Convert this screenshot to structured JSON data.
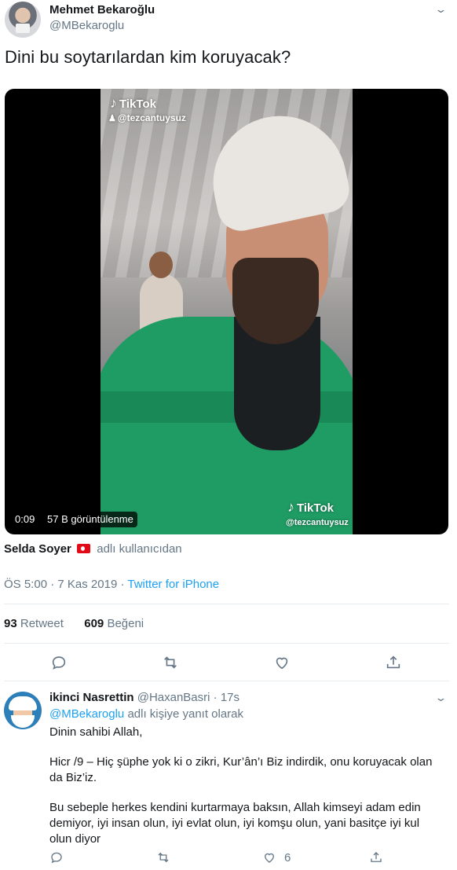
{
  "tweet": {
    "author": {
      "name": "Mehmet Bekaroğlu",
      "handle": "@MBekaroglu",
      "avatar_icon": "profile-photo"
    },
    "text": "Dini bu soytarılardan kim koruyacak?",
    "video": {
      "watermark_brand": "TikTok",
      "watermark_handle": "@tezcantuysuz",
      "duration": "0:09",
      "views": "57 B görüntülenme"
    },
    "source": {
      "user": "Selda Soyer",
      "flag_icon": "turkey-flag-icon",
      "suffix": "adlı kullanıcıdan"
    },
    "meta": {
      "time": "ÖS 5:00",
      "separator": "·",
      "date": "7 Kas 2019",
      "client": "Twitter for iPhone"
    },
    "stats": {
      "retweet_count": "93",
      "retweet_label": "Retweet",
      "like_count": "609",
      "like_label": "Beğeni"
    },
    "actions": [
      "reply-icon",
      "retweet-icon",
      "like-icon",
      "share-icon"
    ]
  },
  "reply": {
    "author": {
      "name": "ikinci Nasrettin",
      "handle": "@HaxanBasri",
      "time": "· 17s"
    },
    "replying_to": {
      "mention": "@MBekaroglu",
      "suffix": "adlı kişiye yanıt olarak"
    },
    "lines": [
      "Dinin sahibi Allah,",
      "Hicr /9 – Hiç şüphe yok ki o zikri, Kur’ân’ı Biz indirdik, onu koruyacak olan",
      "da Biz’iz.",
      "Bu sebeple herkes kendini kurtarmaya baksın, Allah kimseyi adam edin",
      "demiyor, iyi insan olun, iyi evlat olun, iyi komşu olun, yani basitçe iyi kul",
      "olun diyor"
    ],
    "like_count": "6"
  },
  "colors": {
    "accent": "#1da1f2",
    "muted": "#657786",
    "text": "#14171a",
    "divider": "#e6ecf0",
    "flag_red": "#e30a17"
  }
}
